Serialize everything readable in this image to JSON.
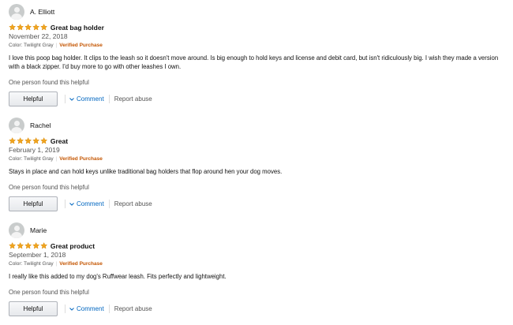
{
  "labels": {
    "verified_purchase": "Verified Purchase",
    "helpful_button": "Helpful",
    "comment": "Comment",
    "report_abuse": "Report abuse"
  },
  "colors": {
    "star": "#f0a41e",
    "verified": "#c45500",
    "link": "#0066c0"
  },
  "reviews": [
    {
      "author": "A. Elliott",
      "rating": 5,
      "title": "Great bag holder",
      "date": "November 22, 2018",
      "color": "Color: Twilight Gray",
      "body": "I love this poop bag holder. It clips to the leash so it doesn't move around. Is big enough to hold keys and license and debit card, but isn't ridiculously big. I wish they made a version with a black zipper. I'd buy more to go with other leashes I own.",
      "helpful_text": "One person found this helpful"
    },
    {
      "author": "Rachel",
      "rating": 5,
      "title": "Great",
      "date": "February 1, 2019",
      "color": "Color: Twilight Gray",
      "body": "Stays in place and can hold keys unlike traditional bag holders that flop around hen your dog moves.",
      "helpful_text": "One person found this helpful"
    },
    {
      "author": "Marie",
      "rating": 5,
      "title": "Great product",
      "date": "September 1, 2018",
      "color": "Color: Twilight Gray",
      "body": "I really like this added to my dog's Ruffwear leash. Fits perfectly and lightweight.",
      "helpful_text": "One person found this helpful"
    }
  ]
}
